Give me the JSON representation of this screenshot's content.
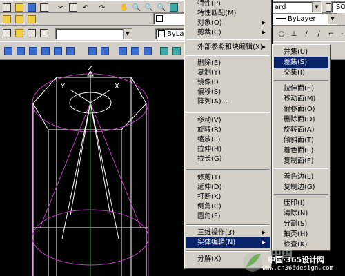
{
  "toolbar": {
    "text_style_combo": "ard",
    "dim_style_combo": "ISO-",
    "layer_combo": "ByLayer",
    "linetype_combo": "ByLayer"
  },
  "axes": {
    "z": "Z",
    "x": "X",
    "y": "Y"
  },
  "main_menu": {
    "items": [
      {
        "label": "特性(P)",
        "arrow": false
      },
      {
        "label": "特性匹配(M)",
        "arrow": false
      },
      {
        "label": "对象(O)",
        "arrow": true
      },
      {
        "label": "剪裁(C)",
        "arrow": true
      },
      {
        "label": "外部参照和块编辑(X)",
        "arrow": true
      },
      {
        "label": "删除(E)",
        "arrow": false
      },
      {
        "label": "复制(Y)",
        "arrow": false
      },
      {
        "label": "镜像(I)",
        "arrow": false
      },
      {
        "label": "偏移(S)",
        "arrow": false
      },
      {
        "label": "阵列(A)...",
        "arrow": false
      },
      {
        "label": "移动(V)",
        "arrow": false
      },
      {
        "label": "旋转(R)",
        "arrow": false
      },
      {
        "label": "缩放(L)",
        "arrow": false
      },
      {
        "label": "拉伸(H)",
        "arrow": false
      },
      {
        "label": "拉长(G)",
        "arrow": false
      },
      {
        "label": "修剪(T)",
        "arrow": false
      },
      {
        "label": "延伸(D)",
        "arrow": false
      },
      {
        "label": "打断(K)",
        "arrow": false
      },
      {
        "label": "倒角(C)",
        "arrow": false
      },
      {
        "label": "圆角(F)",
        "arrow": false
      },
      {
        "label": "三维操作(3)",
        "arrow": true
      },
      {
        "label": "实体编辑(N)",
        "arrow": true
      },
      {
        "label": "分解(X)",
        "arrow": false
      }
    ]
  },
  "sub_menu": {
    "items": [
      {
        "label": "并集(U)"
      },
      {
        "label": "差集(S)"
      },
      {
        "label": "交集(I)"
      },
      {
        "label": "拉伸面(E)"
      },
      {
        "label": "移动面(M)"
      },
      {
        "label": "偏移面(O)"
      },
      {
        "label": "删除面(D)"
      },
      {
        "label": "旋转面(A)"
      },
      {
        "label": "倾斜面(T)"
      },
      {
        "label": "着色面(L)"
      },
      {
        "label": "复制面(F)"
      },
      {
        "label": "着色边(L)"
      },
      {
        "label": "复制边(G)"
      },
      {
        "label": "压印(I)"
      },
      {
        "label": "清除(N)"
      },
      {
        "label": "分割(S)"
      },
      {
        "label": "抽壳(H)"
      },
      {
        "label": "检查(K)"
      }
    ]
  },
  "watermark": {
    "logo_text": "中国",
    "site": "中国·365设计网",
    "url": "www.cn365design.com"
  },
  "colors": {
    "menu_bg": "#d4d0c8",
    "highlight": "#0a246a",
    "wire_magenta": "#c040c0",
    "wire_white": "#ffffff",
    "axis_green": "#20c020"
  }
}
